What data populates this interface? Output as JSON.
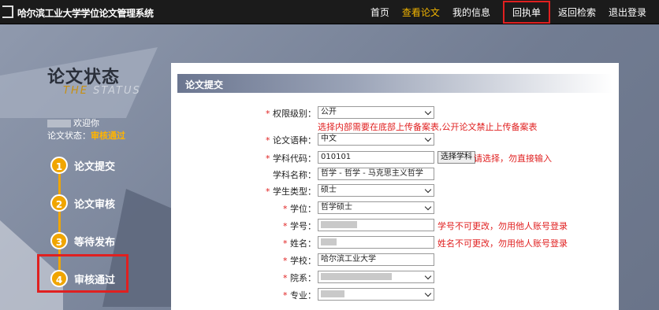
{
  "site_title": "哈尔滨工业大学学位论文管理系统",
  "nav": [
    "首页",
    "查看论文",
    "我的信息",
    "回执单",
    "返回检索",
    "退出登录"
  ],
  "sidebar": {
    "title_cn": "论文状态",
    "title_en_highlight": "THE",
    "title_en_rest": "STATUS",
    "welcome": "欢迎你",
    "status_label": "论文状态：",
    "status_value": "审核通过",
    "steps": [
      {
        "num": "1",
        "label": "论文提交"
      },
      {
        "num": "2",
        "label": "论文审核"
      },
      {
        "num": "3",
        "label": "等待发布"
      },
      {
        "num": "4",
        "label": "审核通过"
      }
    ]
  },
  "form": {
    "heading": "论文提交",
    "permission": {
      "label": "权限级别：",
      "value": "公开",
      "hint": "选择内部需要在底部上传备案表,公开论文禁止上传备案表"
    },
    "language": {
      "label": "论文语种：",
      "value": "中文"
    },
    "subject_code": {
      "label": "学科代码：",
      "value": "010101",
      "button": "选择学科",
      "hint": "请选择，勿直接输入"
    },
    "subject_name": {
      "label": "学科名称：",
      "value": "哲学 - 哲学 - 马克思主义哲学"
    },
    "student_type": {
      "label": "学生类型：",
      "value": "硕士"
    },
    "degree": {
      "label": "学位：",
      "value": "哲学硕士"
    },
    "student_id": {
      "label": "学号：",
      "hint": "学号不可更改，勿用他人账号登录"
    },
    "name": {
      "label": "姓名：",
      "hint": "姓名不可更改，勿用他人账号登录"
    },
    "school": {
      "label": "学校：",
      "value": "哈尔滨工业大学"
    },
    "department": {
      "label": "院系："
    },
    "major": {
      "label": "专业："
    }
  },
  "colors": {
    "accent": "#f0a500",
    "alert": "#e02020",
    "topbar": "#1b1b1b"
  }
}
